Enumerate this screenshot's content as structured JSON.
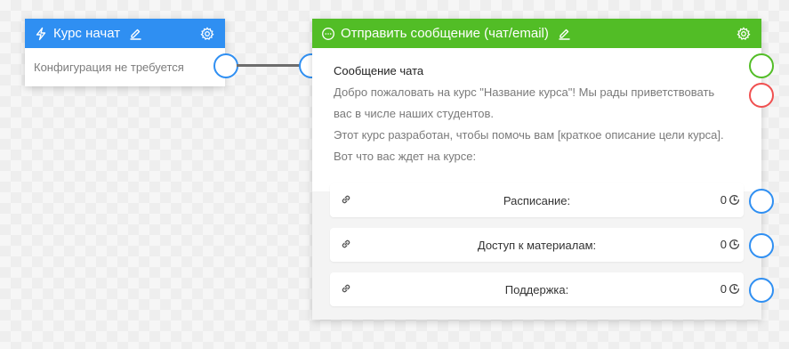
{
  "start_node": {
    "title": "Курс начат",
    "body": "Конфигурация не требуется",
    "color": "#2f8ff2"
  },
  "message_node": {
    "title": "Отправить сообщение (чат/email)",
    "color": "#52bd26",
    "message_title": "Сообщение чата",
    "lines": [
      "Добро пожаловать на курс \"Название курса\"! Мы рады приветствовать",
      "вас в числе наших студентов.",
      "Этот курс разработан, чтобы помочь вам [краткое описание цели курса].",
      "Вот что вас ждет на курсе:"
    ],
    "buttons": [
      {
        "label": "Расписание:",
        "count": "0"
      },
      {
        "label": "Доступ к материалам:",
        "count": "0"
      },
      {
        "label": "Поддержка:",
        "count": "0"
      }
    ]
  },
  "icons": {
    "start_icon": "lightning-icon",
    "message_icon": "chat-bubble-icon",
    "edit_icon": "pencil-icon",
    "settings_icon": "gear-icon",
    "link_icon": "link-icon",
    "count_icon": "clock-icon"
  }
}
